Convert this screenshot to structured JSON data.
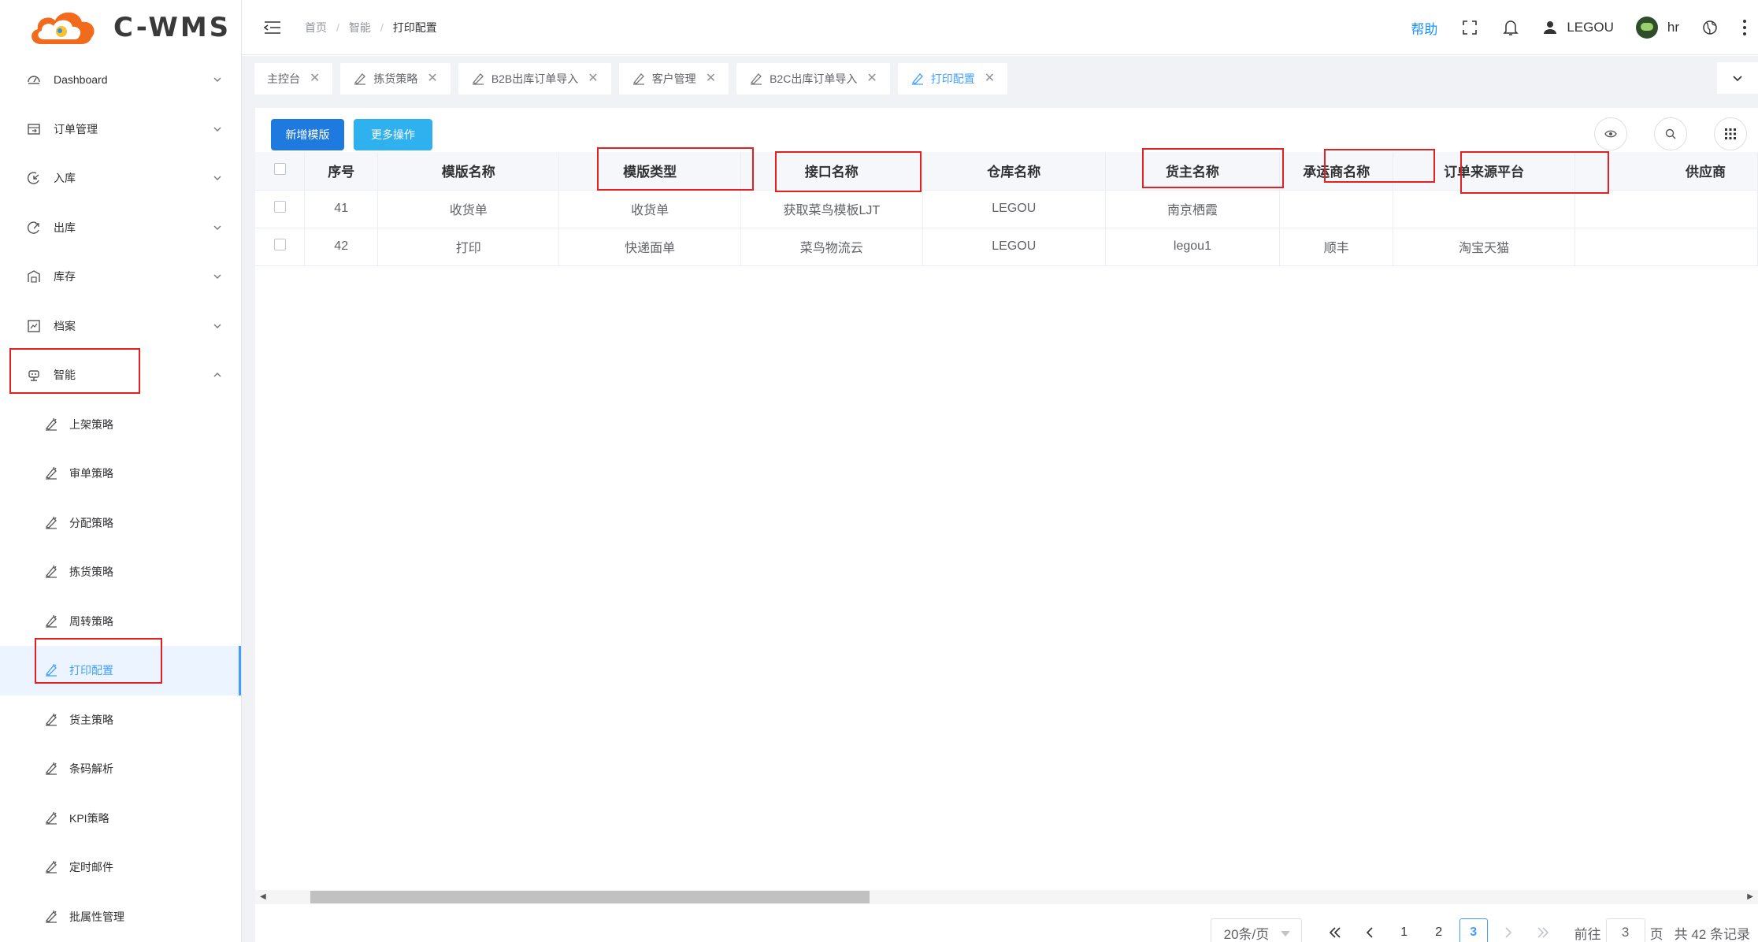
{
  "app": {
    "logo_text": "C-WMS"
  },
  "sidebar": {
    "menu": [
      {
        "label": "Dashboard",
        "icon": "dashboard-icon"
      },
      {
        "label": "订单管理",
        "icon": "order-icon"
      },
      {
        "label": "入库",
        "icon": "inbound-icon"
      },
      {
        "label": "出库",
        "icon": "outbound-icon"
      },
      {
        "label": "库存",
        "icon": "inventory-icon"
      },
      {
        "label": "档案",
        "icon": "archive-icon"
      },
      {
        "label": "智能",
        "icon": "robot-icon"
      }
    ],
    "submenu": [
      {
        "label": "上架策略"
      },
      {
        "label": "审单策略"
      },
      {
        "label": "分配策略"
      },
      {
        "label": "拣货策略"
      },
      {
        "label": "周转策略"
      },
      {
        "label": "打印配置"
      },
      {
        "label": "货主策略"
      },
      {
        "label": "条码解析"
      },
      {
        "label": "KPI策略"
      },
      {
        "label": "定时邮件"
      },
      {
        "label": "批属性管理"
      }
    ],
    "active_submenu": "打印配置"
  },
  "header": {
    "breadcrumb": [
      "首页",
      "智能",
      "打印配置"
    ],
    "breadcrumb_sep": "/",
    "help": "帮助",
    "user_name": "LEGOU",
    "account": "hr"
  },
  "tabs": [
    {
      "label": "主控台"
    },
    {
      "label": "拣货策略"
    },
    {
      "label": "B2B出库订单导入"
    },
    {
      "label": "客户管理"
    },
    {
      "label": "B2C出库订单导入"
    },
    {
      "label": "打印配置"
    }
  ],
  "toolbar": {
    "add_label": "新增模版",
    "more_label": "更多操作"
  },
  "table": {
    "columns": [
      "序号",
      "模版名称",
      "模版类型",
      "接口名称",
      "仓库名称",
      "货主名称",
      "承运商名称",
      "订单来源平台",
      "供应商"
    ],
    "rows": [
      [
        "41",
        "收货单",
        "收货单",
        "获取菜鸟模板LJT",
        "LEGOU",
        "南京栖霞",
        "",
        "",
        ""
      ],
      [
        "42",
        "打印",
        "快递面单",
        "菜鸟物流云",
        "LEGOU",
        "legou1",
        "顺丰",
        "淘宝天猫",
        ""
      ]
    ]
  },
  "pagination": {
    "page_size": "20条/页",
    "pages": [
      "1",
      "2",
      "3"
    ],
    "current": "3",
    "goto_prefix": "前往",
    "goto_value": "3",
    "goto_suffix": "页",
    "total": "共 42 条记录"
  },
  "colors": {
    "accent": "#409eff",
    "primary_btn": "#1f7ae0",
    "info_btn": "#2fb1f0",
    "highlight": "#e52020"
  }
}
